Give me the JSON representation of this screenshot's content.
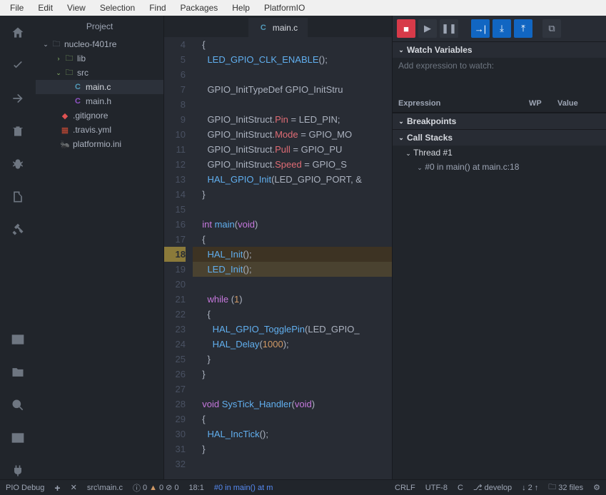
{
  "menu": [
    "File",
    "Edit",
    "View",
    "Selection",
    "Find",
    "Packages",
    "Help",
    "PlatformIO"
  ],
  "sidebar": {
    "title": "Project",
    "tree": {
      "root": "nucleo-f401re",
      "lib": "lib",
      "src": "src",
      "mainc": "main.c",
      "mainh": "main.h",
      "gitignore": ".gitignore",
      "travis": ".travis.yml",
      "pio": "platformio.ini"
    }
  },
  "tab": {
    "label": "main.c"
  },
  "code": {
    "start": 4,
    "current": 18,
    "lines": [
      "  {",
      "    LED_GPIO_CLK_ENABLE();",
      "",
      "    GPIO_InitTypeDef GPIO_InitStru",
      "",
      "    GPIO_InitStruct.Pin = LED_PIN;",
      "    GPIO_InitStruct.Mode = GPIO_MO",
      "    GPIO_InitStruct.Pull = GPIO_PU",
      "    GPIO_InitStruct.Speed = GPIO_S",
      "    HAL_GPIO_Init(LED_GPIO_PORT, &",
      "  }",
      "",
      "  int main(void)",
      "  {",
      "    HAL_Init();",
      "    LED_Init();",
      "",
      "    while (1)",
      "    {",
      "      HAL_GPIO_TogglePin(LED_GPIO_",
      "      HAL_Delay(1000);",
      "    }",
      "  }",
      "",
      "  void SysTick_Handler(void)",
      "  {",
      "    HAL_IncTick();",
      "  }",
      ""
    ]
  },
  "debug": {
    "watch_title": "Watch Variables",
    "watch_placeholder": "Add expression to watch:",
    "cols": {
      "expr": "Expression",
      "wp": "WP",
      "val": "Value"
    },
    "bp_title": "Breakpoints",
    "cs_title": "Call Stacks",
    "thread": "Thread #1",
    "frame": "#0 in main() at main.c:18"
  },
  "status": {
    "debug": "PIO Debug",
    "path": "src\\main.c",
    "issues_i": "0",
    "issues_w": "0",
    "issues_e": "0",
    "pos": "18:1",
    "frame": "#0 in main() at m",
    "eol": "CRLF",
    "enc": "UTF-8",
    "lang": "C",
    "branch": "develop",
    "down": "2",
    "files": "32 files"
  }
}
